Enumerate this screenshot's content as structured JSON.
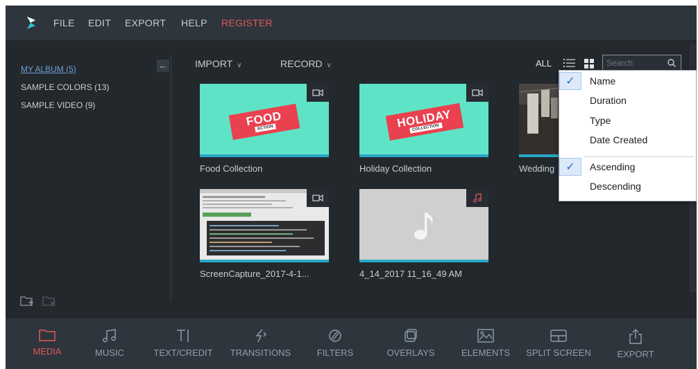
{
  "menu": {
    "items": [
      "FILE",
      "EDIT",
      "EXPORT",
      "HELP"
    ],
    "register": "REGISTER"
  },
  "sidebar": {
    "albums": [
      {
        "label": "MY ALBUM (5)",
        "selected": true
      },
      {
        "label": "SAMPLE COLORS (13)"
      },
      {
        "label": "SAMPLE VIDEO (9)"
      }
    ],
    "collapse_icon": "arrow-left-icon",
    "add_folder_icon": "add-folder-icon",
    "delete_folder_icon": "delete-folder-icon"
  },
  "toolbar": {
    "import_label": "IMPORT",
    "record_label": "RECORD",
    "filter_label": "ALL",
    "search_placeholder": "Search"
  },
  "media": [
    {
      "label": "Food Collection",
      "kind": "video",
      "banner_main": "FOOD",
      "banner_sub": "ECTION"
    },
    {
      "label": "Holiday Collection",
      "kind": "video",
      "banner_main": "HOLIDAY",
      "banner_sub": "COLLECTION"
    },
    {
      "label": "Wedding",
      "kind": "video"
    },
    {
      "label": "ScreenCapture_2017-4-1...",
      "kind": "video"
    },
    {
      "label": "4_14_2017 11_16_49 AM",
      "kind": "audio"
    }
  ],
  "sort_menu": {
    "fields": [
      {
        "label": "Name",
        "checked": true
      },
      {
        "label": "Duration",
        "checked": false
      },
      {
        "label": "Type",
        "checked": false
      },
      {
        "label": "Date Created",
        "checked": false
      }
    ],
    "orders": [
      {
        "label": "Ascending",
        "checked": true
      },
      {
        "label": "Descending",
        "checked": false
      }
    ]
  },
  "bottom_tabs": [
    {
      "label": "MEDIA",
      "icon": "folder-icon",
      "active": true
    },
    {
      "label": "MUSIC",
      "icon": "music-note-icon"
    },
    {
      "label": "TEXT/CREDIT",
      "icon": "text-cursor-icon"
    },
    {
      "label": "TRANSITIONS",
      "icon": "transition-icon"
    },
    {
      "label": "FILTERS",
      "icon": "filter-icon"
    },
    {
      "label": "OVERLAYS",
      "icon": "overlay-icon"
    },
    {
      "label": "ELEMENTS",
      "icon": "image-icon"
    },
    {
      "label": "SPLIT SCREEN",
      "icon": "split-screen-icon"
    },
    {
      "label": "EXPORT",
      "icon": "share-export-icon"
    }
  ],
  "colors": {
    "accent": "#e0595a",
    "thumb_teal": "#5fe3c6",
    "progress_blue": "#29a8c7",
    "link_blue": "#6ea0d6"
  }
}
